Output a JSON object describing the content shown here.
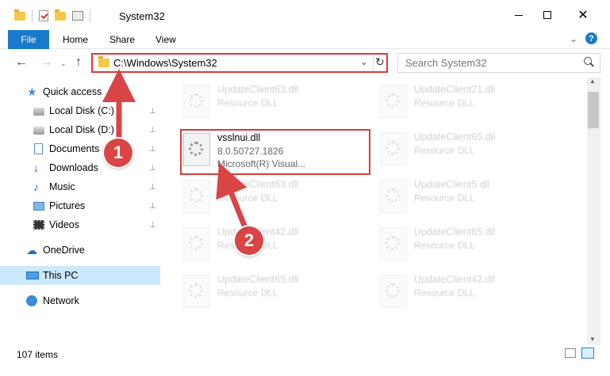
{
  "window": {
    "title": "System32",
    "minimize": "—",
    "maximize": "☐",
    "close": "✕"
  },
  "ribbon": {
    "tabs": [
      {
        "label": "File"
      },
      {
        "label": "Home"
      },
      {
        "label": "Share"
      },
      {
        "label": "View"
      }
    ],
    "help": "?",
    "expand": "⌄"
  },
  "nav": {
    "back": "←",
    "forward": "→",
    "recent": "⌄",
    "up": "↑",
    "address": "C:\\Windows\\System32",
    "address_dropdown": "⌄",
    "refresh": "↻",
    "search_placeholder": "Search System32"
  },
  "sidebar": {
    "items": [
      {
        "label": "Quick access",
        "icon": "star-icon"
      },
      {
        "label": "Local Disk (C:)",
        "icon": "disk-icon",
        "pinned": true
      },
      {
        "label": "Local Disk (D:)",
        "icon": "disk-icon",
        "pinned": true
      },
      {
        "label": "Documents",
        "icon": "documents-icon",
        "pinned": true
      },
      {
        "label": "Downloads",
        "icon": "download-icon",
        "pinned": true
      },
      {
        "label": "Music",
        "icon": "music-icon",
        "pinned": true
      },
      {
        "label": "Pictures",
        "icon": "pictures-icon",
        "pinned": true
      },
      {
        "label": "Videos",
        "icon": "videos-icon",
        "pinned": true
      },
      {
        "label": "OneDrive",
        "icon": "cloud-icon"
      },
      {
        "label": "This PC",
        "icon": "computer-icon",
        "selected": true
      },
      {
        "label": "Network",
        "icon": "network-icon"
      }
    ],
    "pin_glyph": "📌"
  },
  "files": {
    "highlighted": {
      "name": "vsslnui.dll",
      "version": "8.0.50727.1826",
      "description": "Microsoft(R) Visual..."
    },
    "faded": [
      {
        "name": "UpdateClient63.dll",
        "type": "Resource DLL"
      },
      {
        "name": "UpdateClient21.dll",
        "type": "Resource DLL"
      },
      {
        "name": "UpdateClient65.dll",
        "type": "Resource DLL"
      },
      {
        "name": "UpdateClient63.dll",
        "type": "Resource DLL"
      },
      {
        "name": "UpdateClient5.dll",
        "type": "Resource DLL"
      },
      {
        "name": "UpdateClient42.dll",
        "type": "Resource DLL"
      },
      {
        "name": "UpdateClient65.dll",
        "type": "Resource DLL"
      },
      {
        "name": "UpdateClient65.dll",
        "type": "Resource DLL"
      },
      {
        "name": "UpdateClient42.dll",
        "type": "Resource DLL"
      }
    ]
  },
  "status": {
    "item_count": "107 items"
  },
  "annotations": {
    "step1": "1",
    "step2": "2",
    "accent_color": "#d94444",
    "highlight_color": "#d63a3a"
  },
  "colors": {
    "file_tab": "#1979ca",
    "selected_bg": "#cce8ff"
  }
}
